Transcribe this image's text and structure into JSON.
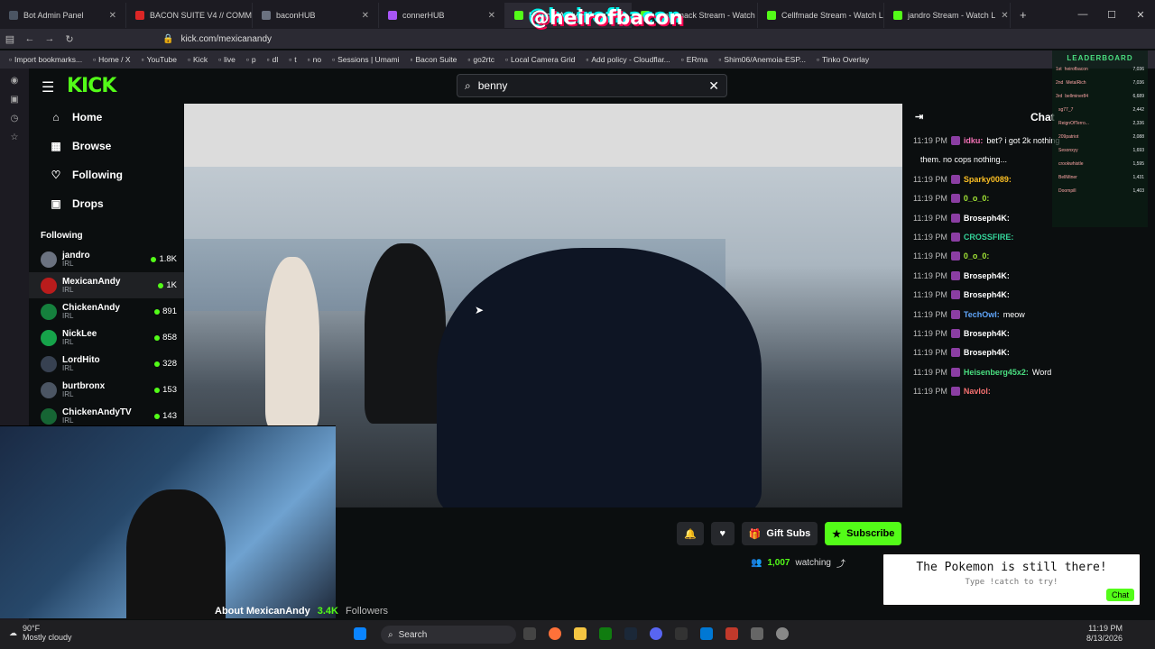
{
  "browser": {
    "tabs": [
      {
        "label": "Bot Admin Panel",
        "color": "#4b5563"
      },
      {
        "label": "BACON SUITE V4 // COMMA",
        "color": "#dc2626"
      },
      {
        "label": "baconHUB",
        "color": "#6b7280"
      },
      {
        "label": "connerHUB",
        "color": "#a855f7"
      },
      {
        "label": "MexicanAndy Stream",
        "color": "#53fc18"
      },
      {
        "label": "bennymack Stream - Watch",
        "color": "#53fc18"
      },
      {
        "label": "Cellfmade Stream - Watch L",
        "color": "#53fc18"
      },
      {
        "label": "jandro Stream - Watch L",
        "color": "#53fc18"
      }
    ],
    "url": "kick.com/mexicanandy",
    "bookmarks": [
      "Import bookmarks...",
      "Home / X",
      "YouTube",
      "Kick",
      "live",
      "p",
      "dl",
      "t",
      "no",
      "Sessions | Umami",
      "Bacon Suite",
      "go2rtc",
      "Local Camera Grid",
      "Add policy - Cloudflar...",
      "ERma",
      "Shim06/Anemoia-ESP...",
      "Tinko Overlay"
    ]
  },
  "overlay": {
    "tiktok_handle": "@heirofbacon"
  },
  "kick": {
    "logo": "KICK",
    "search_value": "benny",
    "nav": [
      {
        "label": "Home",
        "icon": "home-icon",
        "glyph": "⌂"
      },
      {
        "label": "Browse",
        "icon": "browse-icon",
        "glyph": "▦"
      },
      {
        "label": "Following",
        "icon": "heart-icon",
        "glyph": "♡"
      },
      {
        "label": "Drops",
        "icon": "gift-icon",
        "glyph": "▣"
      }
    ],
    "following_header": "Following",
    "following": [
      {
        "name": "jandro",
        "category": "IRL",
        "viewers": "1.8K",
        "color": "#6b7280"
      },
      {
        "name": "MexicanAndy",
        "category": "IRL",
        "viewers": "1K",
        "color": "#b91c1c"
      },
      {
        "name": "ChickenAndy",
        "category": "IRL",
        "viewers": "891",
        "color": "#15803d"
      },
      {
        "name": "NickLee",
        "category": "IRL",
        "viewers": "858",
        "color": "#16a34a"
      },
      {
        "name": "LordHito",
        "category": "IRL",
        "viewers": "328",
        "color": "#374151"
      },
      {
        "name": "burtbronx",
        "category": "IRL",
        "viewers": "153",
        "color": "#4b5563"
      },
      {
        "name": "ChickenAndyTV",
        "category": "IRL",
        "viewers": "143",
        "color": "#166534"
      }
    ],
    "actions": {
      "gift_label": "Gift Subs",
      "subscribe_label": "Subscribe"
    },
    "viewers": "1,007",
    "viewers_label": "watching",
    "about": {
      "title": "About MexicanAndy",
      "followers_count": "3.4K",
      "followers_label": "Followers"
    }
  },
  "chat": {
    "title": "Chat",
    "messages": [
      {
        "time": "11:19 PM",
        "user": "idku:",
        "text": "bet? i got 2k nothing",
        "color": "#f472b6"
      },
      {
        "time": "",
        "user": "",
        "text": "them. no cops nothing...",
        "color": "#ffffff"
      },
      {
        "time": "11:19 PM",
        "user": "Sparky0089:",
        "text": "",
        "color": "#fbbf24"
      },
      {
        "time": "11:19 PM",
        "user": "0_o_0:",
        "text": "",
        "color": "#a3e635"
      },
      {
        "time": "11:19 PM",
        "user": "Broseph4K:",
        "text": "",
        "color": "#ffffff"
      },
      {
        "time": "11:19 PM",
        "user": "CROSSFIRE:",
        "text": "",
        "color": "#34d399"
      },
      {
        "time": "11:19 PM",
        "user": "0_o_0:",
        "text": "",
        "color": "#a3e635"
      },
      {
        "time": "11:19 PM",
        "user": "Broseph4K:",
        "text": "",
        "color": "#ffffff"
      },
      {
        "time": "11:19 PM",
        "user": "Broseph4K:",
        "text": "",
        "color": "#ffffff"
      },
      {
        "time": "11:19 PM",
        "user": "TechOwl:",
        "text": "meow",
        "color": "#60a5fa"
      },
      {
        "time": "11:19 PM",
        "user": "Broseph4K:",
        "text": "",
        "color": "#ffffff"
      },
      {
        "time": "11:19 PM",
        "user": "Broseph4K:",
        "text": "",
        "color": "#ffffff"
      },
      {
        "time": "11:19 PM",
        "user": "Heisenberg45x2:",
        "text": "Word",
        "color": "#4ade80"
      },
      {
        "time": "11:19 PM",
        "user": "Navlol:",
        "text": "",
        "color": "#f87171"
      }
    ]
  },
  "leaderboard": {
    "title": "LEADERBOARD",
    "rows": [
      {
        "rank": "1st",
        "name": "heirofbacon",
        "value": "7,036"
      },
      {
        "rank": "2nd",
        "name": "MetalRich",
        "value": "7,036"
      },
      {
        "rank": "3rd",
        "name": "bellminer84",
        "value": "6,689"
      },
      {
        "rank": "",
        "name": "sg77_7",
        "value": "2,442"
      },
      {
        "rank": "",
        "name": "ReignOfTerro...",
        "value": "2,336"
      },
      {
        "rank": "",
        "name": "209patriot",
        "value": "2,088"
      },
      {
        "rank": "",
        "name": "Sesonxyy",
        "value": "1,693"
      },
      {
        "rank": "",
        "name": "crookwhistle",
        "value": "1,595"
      },
      {
        "rank": "",
        "name": "BellMiner",
        "value": "1,431"
      },
      {
        "rank": "",
        "name": "Doompill",
        "value": "1,403"
      }
    ]
  },
  "pokemon_alert": {
    "line1": "The Pokemon is still there!",
    "line2": "Type !catch to try!",
    "button": "Chat"
  },
  "taskbar": {
    "weather_temp": "90°F",
    "weather_desc": "Mostly cloudy",
    "search": "Search",
    "time": "11:19 PM",
    "date": "8/13/2026"
  }
}
